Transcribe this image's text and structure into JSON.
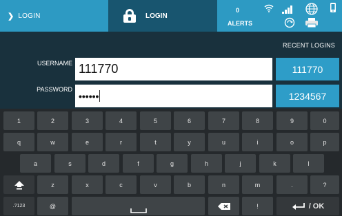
{
  "header": {
    "back_label": "LOGIN",
    "title": "LOGIN",
    "alerts_count": "0",
    "alerts_label": "ALERTS",
    "icons": [
      "wifi-icon",
      "cellular-signal-icon",
      "globe-icon",
      "phone-icon",
      "sync-icon",
      "printer-icon"
    ]
  },
  "form": {
    "recent_title": "RECENT LOGINS",
    "username_label": "USERNAME",
    "username_value": "111770",
    "password_label": "PASSWORD",
    "password_value": "••••••",
    "recent_logins": [
      "111770",
      "1234567"
    ]
  },
  "keyboard": {
    "rows": [
      [
        "1",
        "2",
        "3",
        "4",
        "5",
        "6",
        "7",
        "8",
        "9",
        "0"
      ],
      [
        "q",
        "w",
        "e",
        "r",
        "t",
        "y",
        "u",
        "i",
        "o",
        "p"
      ],
      [
        "a",
        "s",
        "d",
        "f",
        "g",
        "h",
        "j",
        "k",
        "l"
      ],
      [
        "z",
        "x",
        "c",
        "v",
        "b",
        "n",
        "m",
        ".",
        "?"
      ]
    ],
    "shift_icon": "shift-icon",
    "symbols_label": ".?123",
    "at_label": "@",
    "space_icon": "space-icon",
    "backspace_icon": "backspace-icon",
    "bang_label": "!",
    "enter_label": "/ OK"
  },
  "colors": {
    "accent": "#2d9ac3",
    "title_bar": "#18556f",
    "form_bg": "#19313d",
    "recent_button": "#2e9dc8",
    "keyboard_bg": "#25292c",
    "key_bg": "#3f4447"
  }
}
